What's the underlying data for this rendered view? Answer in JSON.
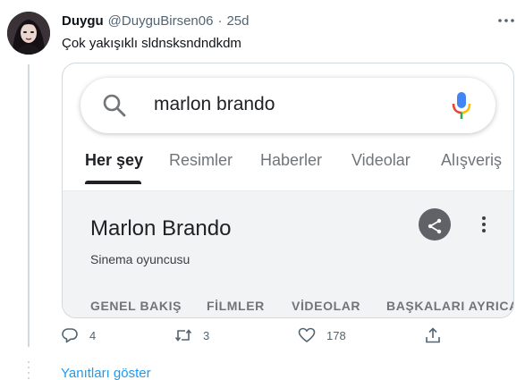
{
  "tweet": {
    "author_name": "Duygu",
    "author_handle": "@DuyguBirsen06",
    "separator": "·",
    "time": "25d",
    "text": "Çok yakışıklı sldnsksndndkdm",
    "avatar_icon": "user-avatar-photo",
    "more_icon": "more-icon"
  },
  "media": {
    "search": {
      "query": "marlon brando",
      "search_icon": "search-icon",
      "mic_icon": "microphone-icon"
    },
    "tabs": [
      {
        "label": "Her şey",
        "active": true
      },
      {
        "label": "Resimler",
        "active": false
      },
      {
        "label": "Haberler",
        "active": false
      },
      {
        "label": "Videolar",
        "active": false
      },
      {
        "label": "Alışveriş",
        "active": false
      }
    ],
    "knowledge_panel": {
      "title": "Marlon Brando",
      "subtitle": "Sinema oyuncusu",
      "share_icon": "share-icon",
      "menu_icon": "more-vertical-icon",
      "tabs": [
        "GENEL BAKIŞ",
        "FİLMLER",
        "VİDEOLAR",
        "BAŞKALARI AYRICA"
      ]
    }
  },
  "actions": {
    "reply_count": "4",
    "retweet_count": "3",
    "like_count": "178",
    "reply_icon": "reply-icon",
    "retweet_icon": "retweet-icon",
    "like_icon": "heart-icon",
    "share_icon": "share-icon"
  },
  "show_replies_label": "Yanıtları göster",
  "colors": {
    "link": "#1d9bf0",
    "muted": "#536471",
    "google_blue": "#4285f4",
    "google_red": "#ea4335",
    "google_yellow": "#fbbc04",
    "google_green": "#34a853"
  }
}
